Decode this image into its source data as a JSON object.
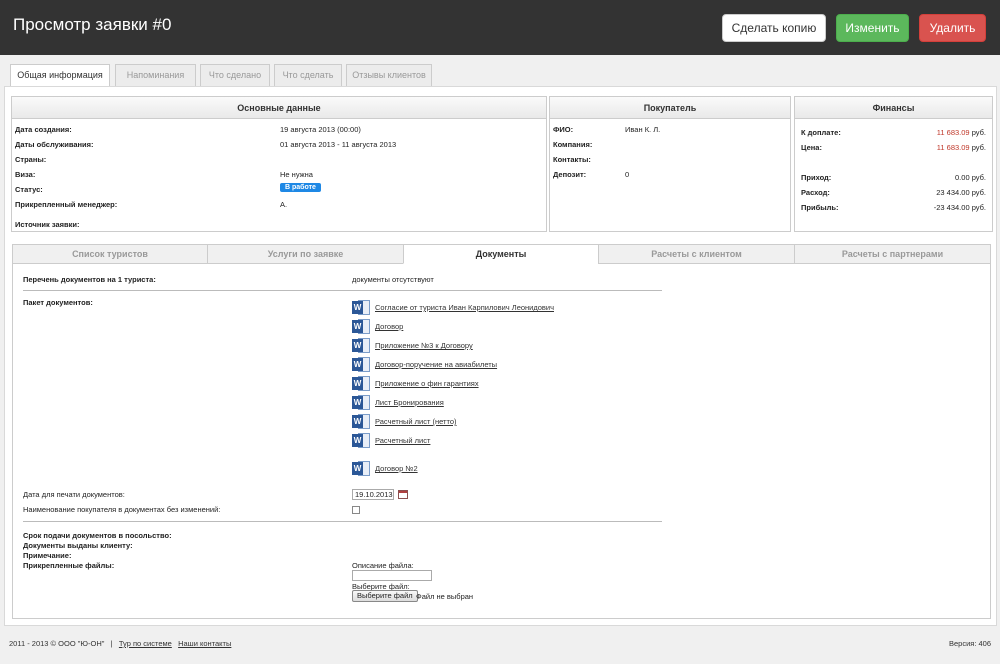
{
  "header": {
    "title": "Просмотр заявки #0",
    "copy_label": "Сделать копию",
    "edit_label": "Изменить",
    "delete_label": "Удалить"
  },
  "tabs": [
    "Общая информация",
    "Напоминания",
    "Что сделано",
    "Что сделать",
    "Отзывы клиентов"
  ],
  "main_data": {
    "title": "Основные данные",
    "rows": [
      {
        "label": "Дата создания:",
        "value": "19 августа 2013 (00:00)"
      },
      {
        "label": "Даты обслуживания:",
        "value": "01 августа 2013 - 11 августа 2013"
      },
      {
        "label": "Страны:",
        "value": ""
      },
      {
        "label": "Виза:",
        "value": "Не нужна"
      },
      {
        "label": "Статус:",
        "value": "В работе"
      },
      {
        "label": "Прикрепленный менеджер:",
        "value": "А."
      },
      {
        "label": "Источник заявки:",
        "value": ""
      }
    ]
  },
  "buyer": {
    "title": "Покупатель",
    "rows": [
      {
        "label": "ФИО:",
        "value": "Иван К. Л."
      },
      {
        "label": "Компания:",
        "value": ""
      },
      {
        "label": "Контакты:",
        "value": ""
      },
      {
        "label": "Депозит:",
        "value": "0"
      }
    ]
  },
  "finance": {
    "title": "Финансы",
    "to_pay_label": "К доплате:",
    "to_pay_value": "11 683.09",
    "price_label": "Цена:",
    "price_value": "11 683.09",
    "currency": "руб.",
    "income_label": "Приход:",
    "income_value": "0.00 руб.",
    "expense_label": "Расход:",
    "expense_value": "23 434.00 руб.",
    "profit_label": "Прибыль:",
    "profit_value": "-23 434.00 руб."
  },
  "subtabs": [
    "Список туристов",
    "Услуги по заявке",
    "Документы",
    "Расчеты с клиентом",
    "Расчеты с партнерами"
  ],
  "documents": {
    "list_label": "Перечень документов на 1 туриста:",
    "list_value": "документы отсутствуют",
    "package_label": "Пакет документов:",
    "items": [
      "Согласие от туриста Иван Карпилович Леонидович",
      "Договор",
      "Приложение №3 к Договору",
      "Договор-поручение на авиабилеты",
      "Приложение о фин гарантиях",
      "Лист Бронирования",
      "Расчетный лист (нетто)",
      "Расчетный лист",
      "Договор №2"
    ],
    "icon_letter": "W",
    "print_date_label": "Дата для печати документов:",
    "print_date_value": "19.10.2013",
    "buyer_name_label": "Наименование покупателя в документах без изменений:",
    "deadline_label": "Срок подачи документов в посольство:",
    "issued_label": "Документы выданы клиенту:",
    "note_label": "Примечание:",
    "files_label": "Прикрепленные файлы:",
    "file_desc_label": "Описание файла:",
    "choose_file_label": "Выберите файл:",
    "choose_file_button": "Выберите файл",
    "no_file_text": "Файл не выбран"
  },
  "footer": {
    "copyright": "2011 - 2013 © ООО \"Ю-ОН\"",
    "separator": "|",
    "tour_link": "Тур по системе",
    "contacts_link": "Наши контакты",
    "version": "Версия: 406"
  }
}
